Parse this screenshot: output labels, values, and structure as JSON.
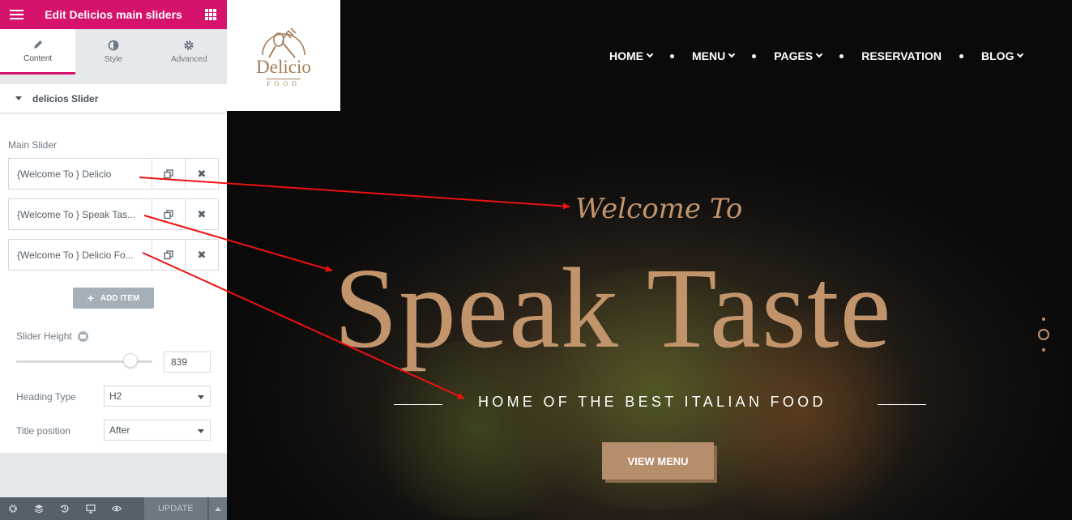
{
  "panel": {
    "title": "Edit Delicios main sliders",
    "tabs": [
      {
        "label": "Content",
        "icon": "pencil-icon"
      },
      {
        "label": "Style",
        "icon": "contrast-icon"
      },
      {
        "label": "Advanced",
        "icon": "gear-icon"
      }
    ],
    "section_title": "delicios Slider",
    "main_slider_label": "Main Slider",
    "items": [
      {
        "label": "{Welcome To } Delicio"
      },
      {
        "label": "{Welcome To } Speak Tas..."
      },
      {
        "label": "{Welcome To } Delicio Fo..."
      }
    ],
    "add_item": "ADD ITEM",
    "slider_height_label": "Slider Height",
    "slider_height_value": "839",
    "heading_type_label": "Heading Type",
    "heading_type_value": "H2",
    "title_position_label": "Title position",
    "title_position_value": "After",
    "update_label": "UPDATE",
    "accent_color": "#d5136d"
  },
  "site": {
    "logo_name": "Delicio",
    "logo_sub": "FOOD",
    "nav": [
      "HOME",
      "MENU",
      "PAGES",
      "RESERVATION",
      "BLOG"
    ],
    "welcome": "Welcome To",
    "title": "Speak Taste",
    "subtitle": "HOME OF THE BEST ITALIAN FOOD",
    "cta": "VIEW MENU",
    "brand_color": "#c1946b"
  }
}
